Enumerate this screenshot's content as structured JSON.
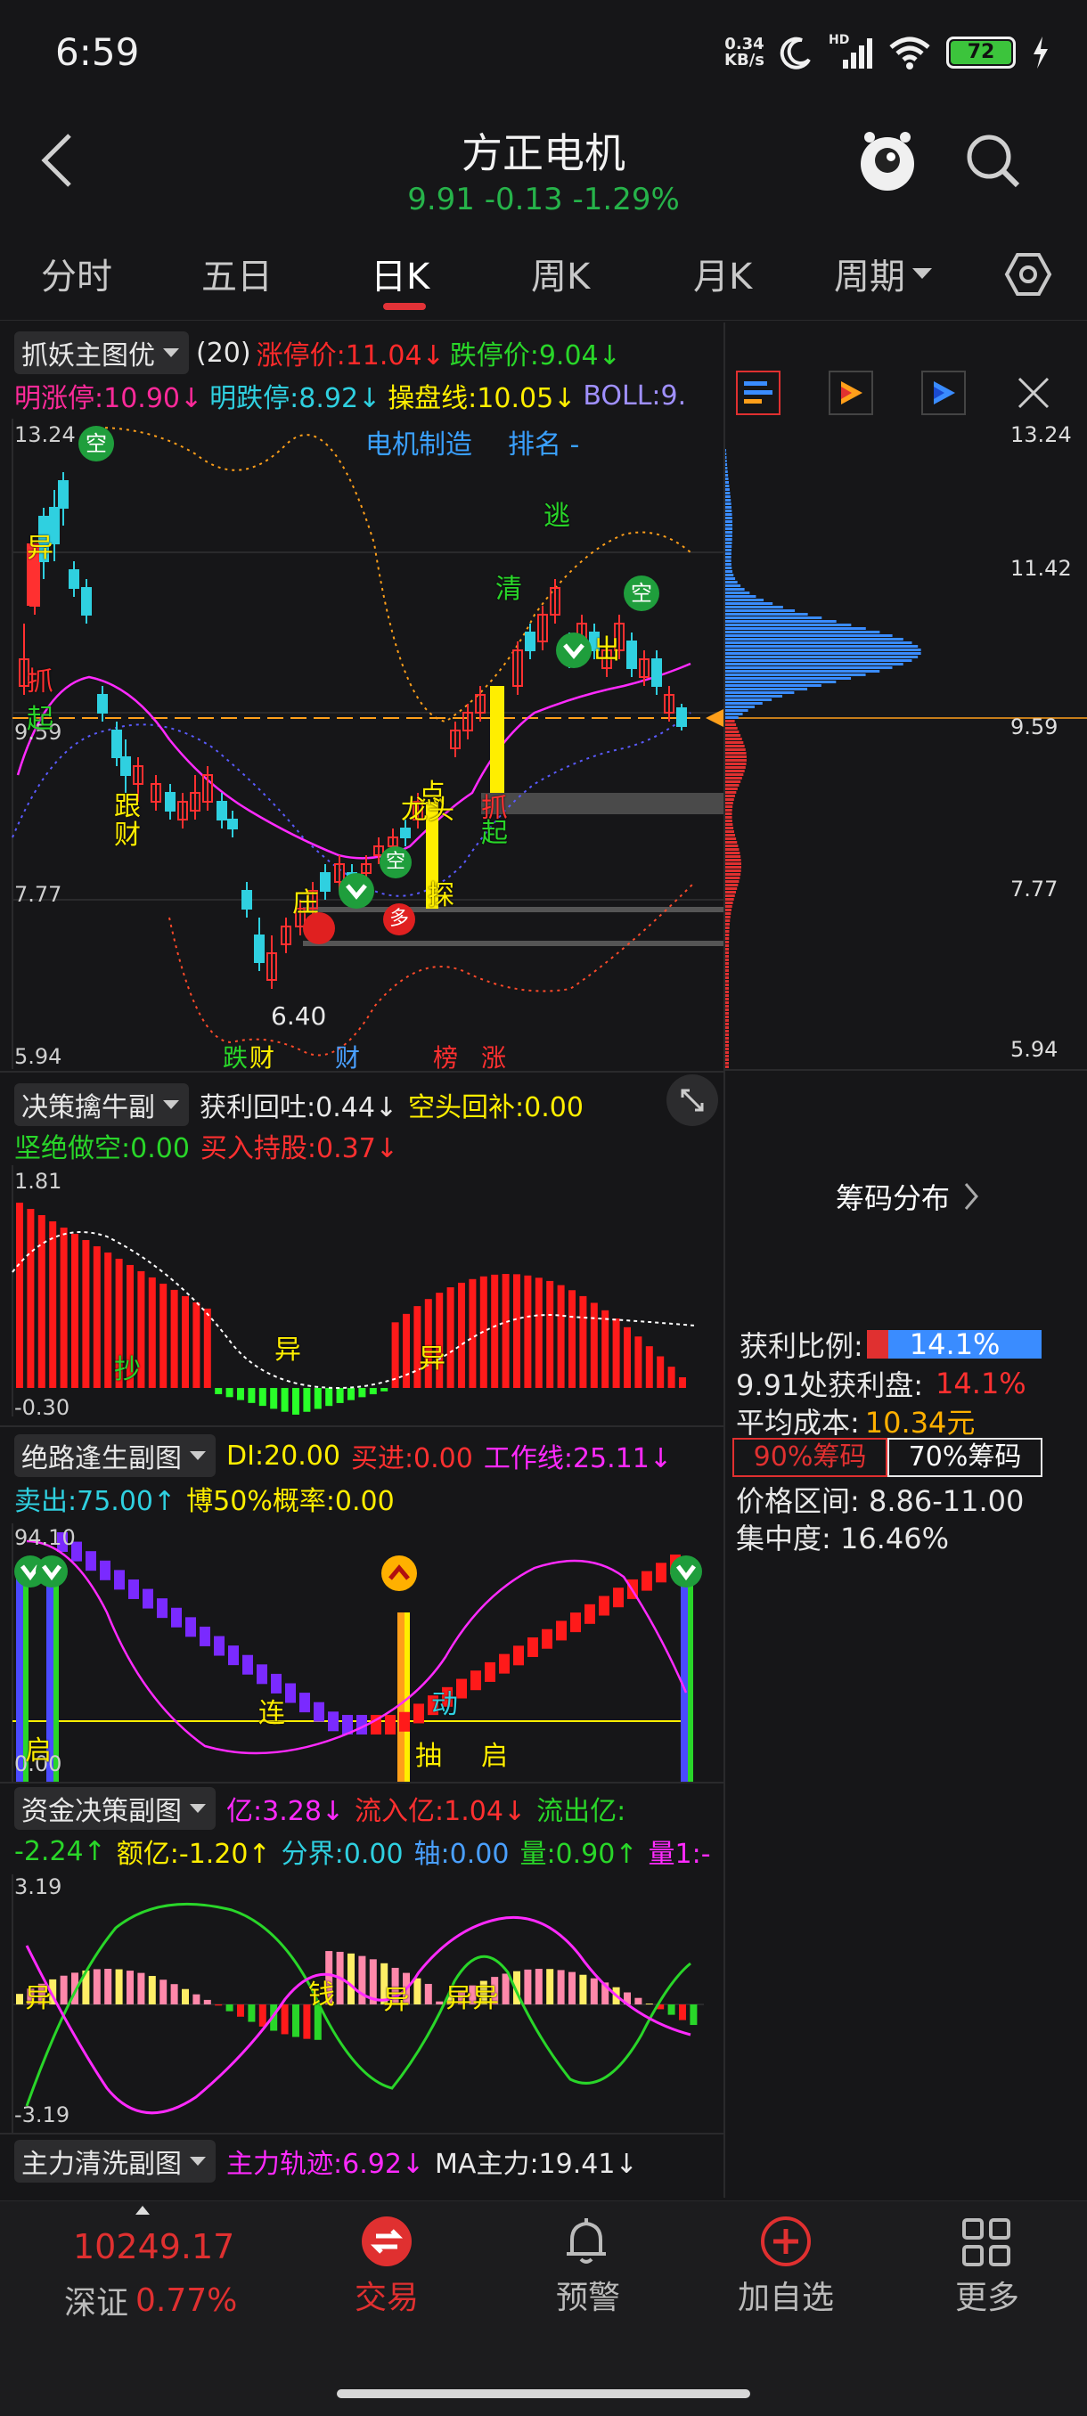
{
  "status_bar": {
    "time": "6:59",
    "net_speed_value": "0.34",
    "net_speed_unit": "KB/s",
    "battery": "72",
    "signal_label": "HD"
  },
  "header": {
    "title": "方正电机",
    "quote": "9.91 -0.13 -1.29%"
  },
  "tabs": [
    "分时",
    "五日",
    "日K",
    "周K",
    "月K",
    "周期"
  ],
  "main_chart": {
    "indicator": "抓妖主图优",
    "line1": [
      {
        "text": "(20)",
        "color": "#e8e8e8"
      },
      {
        "text": "涨停价:11.04↓",
        "color": "#ff2a2a"
      },
      {
        "text": "跌停价:9.04↓",
        "color": "#29d629"
      }
    ],
    "line2": [
      {
        "text": "明涨停:10.90↓",
        "color": "#ff2a9a"
      },
      {
        "text": "明跌停:8.92↓",
        "color": "#2fd0e0"
      },
      {
        "text": "操盘线:10.05↓",
        "color": "#ffee00"
      },
      {
        "text": "BOLL:9.",
        "color": "#a090ff"
      }
    ],
    "sector": "电机制造",
    "rank": "排名 -",
    "y_labels": [
      "13.24",
      "9.59",
      "7.77",
      "5.94"
    ],
    "low_label": "6.40",
    "bottom_tags": [
      {
        "text": "跌",
        "color": "#29d629"
      },
      {
        "text": "财",
        "color": "#ffee00"
      },
      {
        "text": "财",
        "color": "#4aa0ff"
      },
      {
        "text": "榜",
        "color": "#ff3030"
      },
      {
        "text": "涨",
        "color": "#ff3030"
      }
    ],
    "signals": [
      {
        "text": "空",
        "color": "#29d629"
      },
      {
        "text": "异",
        "color": "#ffee00"
      },
      {
        "text": "抓",
        "color": "#ff3030"
      },
      {
        "text": "起",
        "color": "#29d629"
      },
      {
        "text": "跟",
        "color": "#ffee00"
      },
      {
        "text": "财",
        "color": "#ffee00"
      },
      {
        "text": "逃",
        "color": "#29d629"
      },
      {
        "text": "清",
        "color": "#29d629"
      },
      {
        "text": "出",
        "color": "#ffee00"
      },
      {
        "text": "点",
        "color": "#ffee00"
      },
      {
        "text": "龙头",
        "color": "#ffee00"
      },
      {
        "text": "庄",
        "color": "#ffee00"
      },
      {
        "text": "探",
        "color": "#ffee00"
      },
      {
        "text": "抓",
        "color": "#ff3030"
      },
      {
        "text": "起",
        "color": "#29d629"
      },
      {
        "text": "多",
        "color": "#ff3030"
      }
    ]
  },
  "chip_panel": {
    "y_labels": [
      "13.24",
      "11.42",
      "9.59",
      "7.77",
      "5.94"
    ],
    "title": "筹码分布",
    "profit_ratio_label": "获利比例:",
    "profit_ratio": "14.1%",
    "profit_at_label": "9.91处获利盘:",
    "profit_at": "14.1%",
    "avg_cost_label": "平均成本:",
    "avg_cost": "10.34元",
    "chip90": "90%筹码",
    "chip70": "70%筹码",
    "price_range": "价格区间: 8.86-11.00",
    "concentration": "集中度: 16.46%"
  },
  "sub1": {
    "indicator": "决策擒牛副",
    "line1": [
      {
        "text": "获利回吐:0.44↓",
        "color": "#e8e8e8"
      },
      {
        "text": "空头回补:0.00",
        "color": "#ffee00"
      }
    ],
    "line2": [
      {
        "text": "坚绝做空:0.00",
        "color": "#29d629"
      },
      {
        "text": "买入持股:0.37↓",
        "color": "#ff3030"
      }
    ],
    "y_top": "1.81",
    "y_bottom": "-0.30",
    "marks": [
      {
        "text": "抄",
        "color": "#29d629"
      },
      {
        "text": "异",
        "color": "#ffee00"
      },
      {
        "text": "异",
        "color": "#ffee00"
      }
    ]
  },
  "sub2": {
    "indicator": "绝路逢生副图",
    "line1": [
      {
        "text": "DI:20.00",
        "color": "#ffee00"
      },
      {
        "text": "买进:0.00",
        "color": "#ff3030"
      },
      {
        "text": "工作线:25.11↓",
        "color": "#ff2aff"
      }
    ],
    "line2": [
      {
        "text": "卖出:75.00↑",
        "color": "#2fd0e0"
      },
      {
        "text": "博50%概率:0.00",
        "color": "#ffee00"
      }
    ],
    "y_top": "94.10",
    "y_bottom": "0.00",
    "marks": [
      {
        "text": "启",
        "color": "#ffee00"
      },
      {
        "text": "连",
        "color": "#ffee00"
      },
      {
        "text": "动",
        "color": "#2fd0e0"
      },
      {
        "text": "抽",
        "color": "#ffee00"
      },
      {
        "text": "启",
        "color": "#ffee00"
      }
    ]
  },
  "sub3": {
    "indicator": "资金决策副图",
    "line1": [
      {
        "text": "亿:3.28↓",
        "color": "#ff2aff"
      },
      {
        "text": "流入亿:1.04↓",
        "color": "#ff3030"
      },
      {
        "text": "流出亿:",
        "color": "#29d629"
      }
    ],
    "line2": [
      {
        "text": "-2.24↑",
        "color": "#29d629"
      },
      {
        "text": "额亿:-1.20↑",
        "color": "#ffee00"
      },
      {
        "text": "分界:0.00",
        "color": "#2fd0e0"
      },
      {
        "text": "轴:0.00",
        "color": "#4aa0ff"
      },
      {
        "text": "量:0.90↑",
        "color": "#29d629"
      },
      {
        "text": "量1:-",
        "color": "#ff2aff"
      }
    ],
    "y_top": "3.19",
    "y_bottom": "-3.19",
    "marks": [
      {
        "text": "异",
        "color": "#ffee00"
      },
      {
        "text": "钱",
        "color": "#ffee00"
      },
      {
        "text": "异",
        "color": "#ffee00"
      },
      {
        "text": "异异",
        "color": "#ffee00"
      }
    ]
  },
  "sub4": {
    "indicator": "主力清洗副图",
    "line1": [
      {
        "text": "主力轨迹:6.92↓",
        "color": "#ff2aff"
      },
      {
        "text": "MA主力:19.41↓",
        "color": "#e8e8e8"
      }
    ]
  },
  "bottom_nav": {
    "index_value": "10249.17",
    "index_name": "深证",
    "index_change": "0.77%",
    "items": [
      "交易",
      "预警",
      "加自选",
      "更多"
    ]
  }
}
